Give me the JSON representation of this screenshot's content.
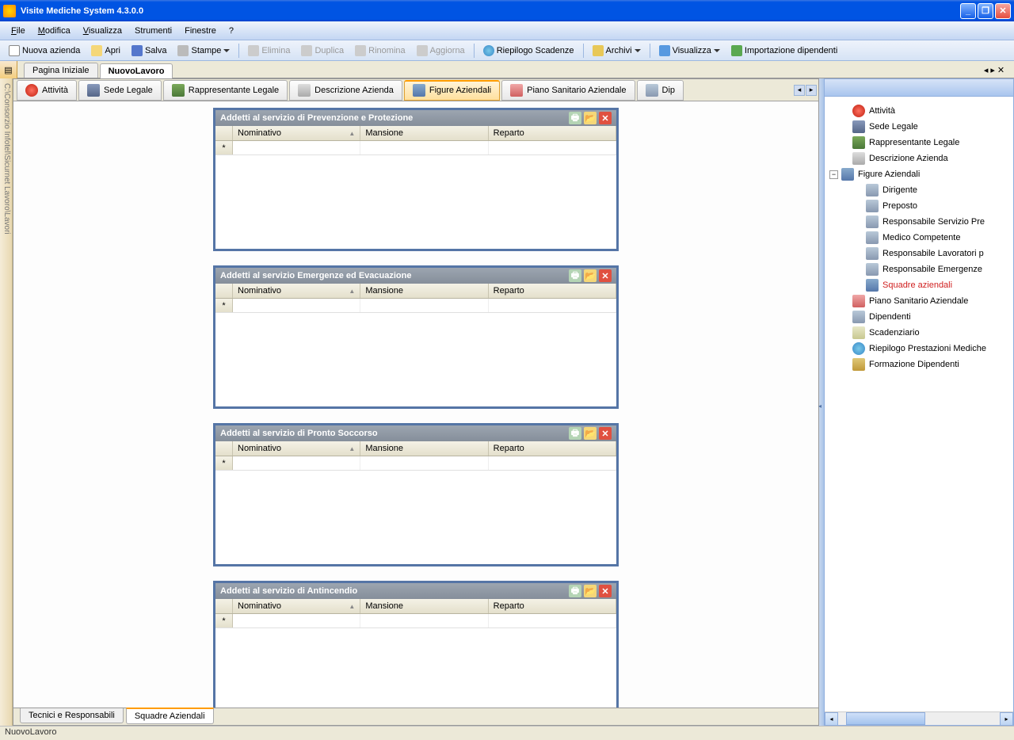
{
  "title": "Visite Mediche System 4.3.0.0",
  "menu": {
    "file": "File",
    "modifica": "Modifica",
    "visualizza": "Visualizza",
    "strumenti": "Strumenti",
    "finestre": "Finestre",
    "help": "?"
  },
  "toolbar": {
    "nuova": "Nuova azienda",
    "apri": "Apri",
    "salva": "Salva",
    "stampe": "Stampe",
    "elimina": "Elimina",
    "duplica": "Duplica",
    "rinomina": "Rinomina",
    "aggiorna": "Aggiorna",
    "riepilogo": "Riepilogo Scadenze",
    "archivi": "Archivi",
    "visualizza": "Visualizza",
    "importazione": "Importazione dipendenti"
  },
  "side_label": "C:\\Consorzio Infotel\\Sicurnet Lavoro\\Lavori",
  "doc_tabs": {
    "pagina": "Pagina Iniziale",
    "nuovo": "NuovoLavoro"
  },
  "ribbon": {
    "attivita": "Attività",
    "sede": "Sede Legale",
    "rappresentante": "Rappresentante Legale",
    "descrizione": "Descrizione Azienda",
    "figure": "Figure Aziendali",
    "piano": "Piano Sanitario Aziendale",
    "dip": "Dip"
  },
  "panels": [
    {
      "title": "Addetti al servizio di Prevenzione e Protezione"
    },
    {
      "title": "Addetti al servizio Emergenze ed Evacuazione"
    },
    {
      "title": "Addetti al servizio di Pronto Soccorso"
    },
    {
      "title": "Addetti al servizio di Antincendio"
    }
  ],
  "columns": {
    "nominativo": "Nominativo",
    "mansione": "Mansione",
    "reparto": "Reparto"
  },
  "bottom_tabs": {
    "tecnici": "Tecnici e Responsabili",
    "squadre": "Squadre Aziendali"
  },
  "tree": {
    "attivita": "Attività",
    "sede": "Sede Legale",
    "rappresentante": "Rappresentante Legale",
    "descrizione": "Descrizione Azienda",
    "figure": "Figure Aziendali",
    "dirigente": "Dirigente",
    "preposto": "Preposto",
    "rsp": "Responsabile Servizio Pre",
    "medico": "Medico Competente",
    "rls": "Responsabile Lavoratori p",
    "remer": "Responsabile Emergenze",
    "squadre": "Squadre aziendali",
    "piano": "Piano Sanitario Aziendale",
    "dipendenti": "Dipendenti",
    "scad": "Scadenziario",
    "riepilogo": "Riepilogo Prestazioni Mediche",
    "formazione": "Formazione Dipendenti"
  },
  "status": "NuovoLavoro"
}
